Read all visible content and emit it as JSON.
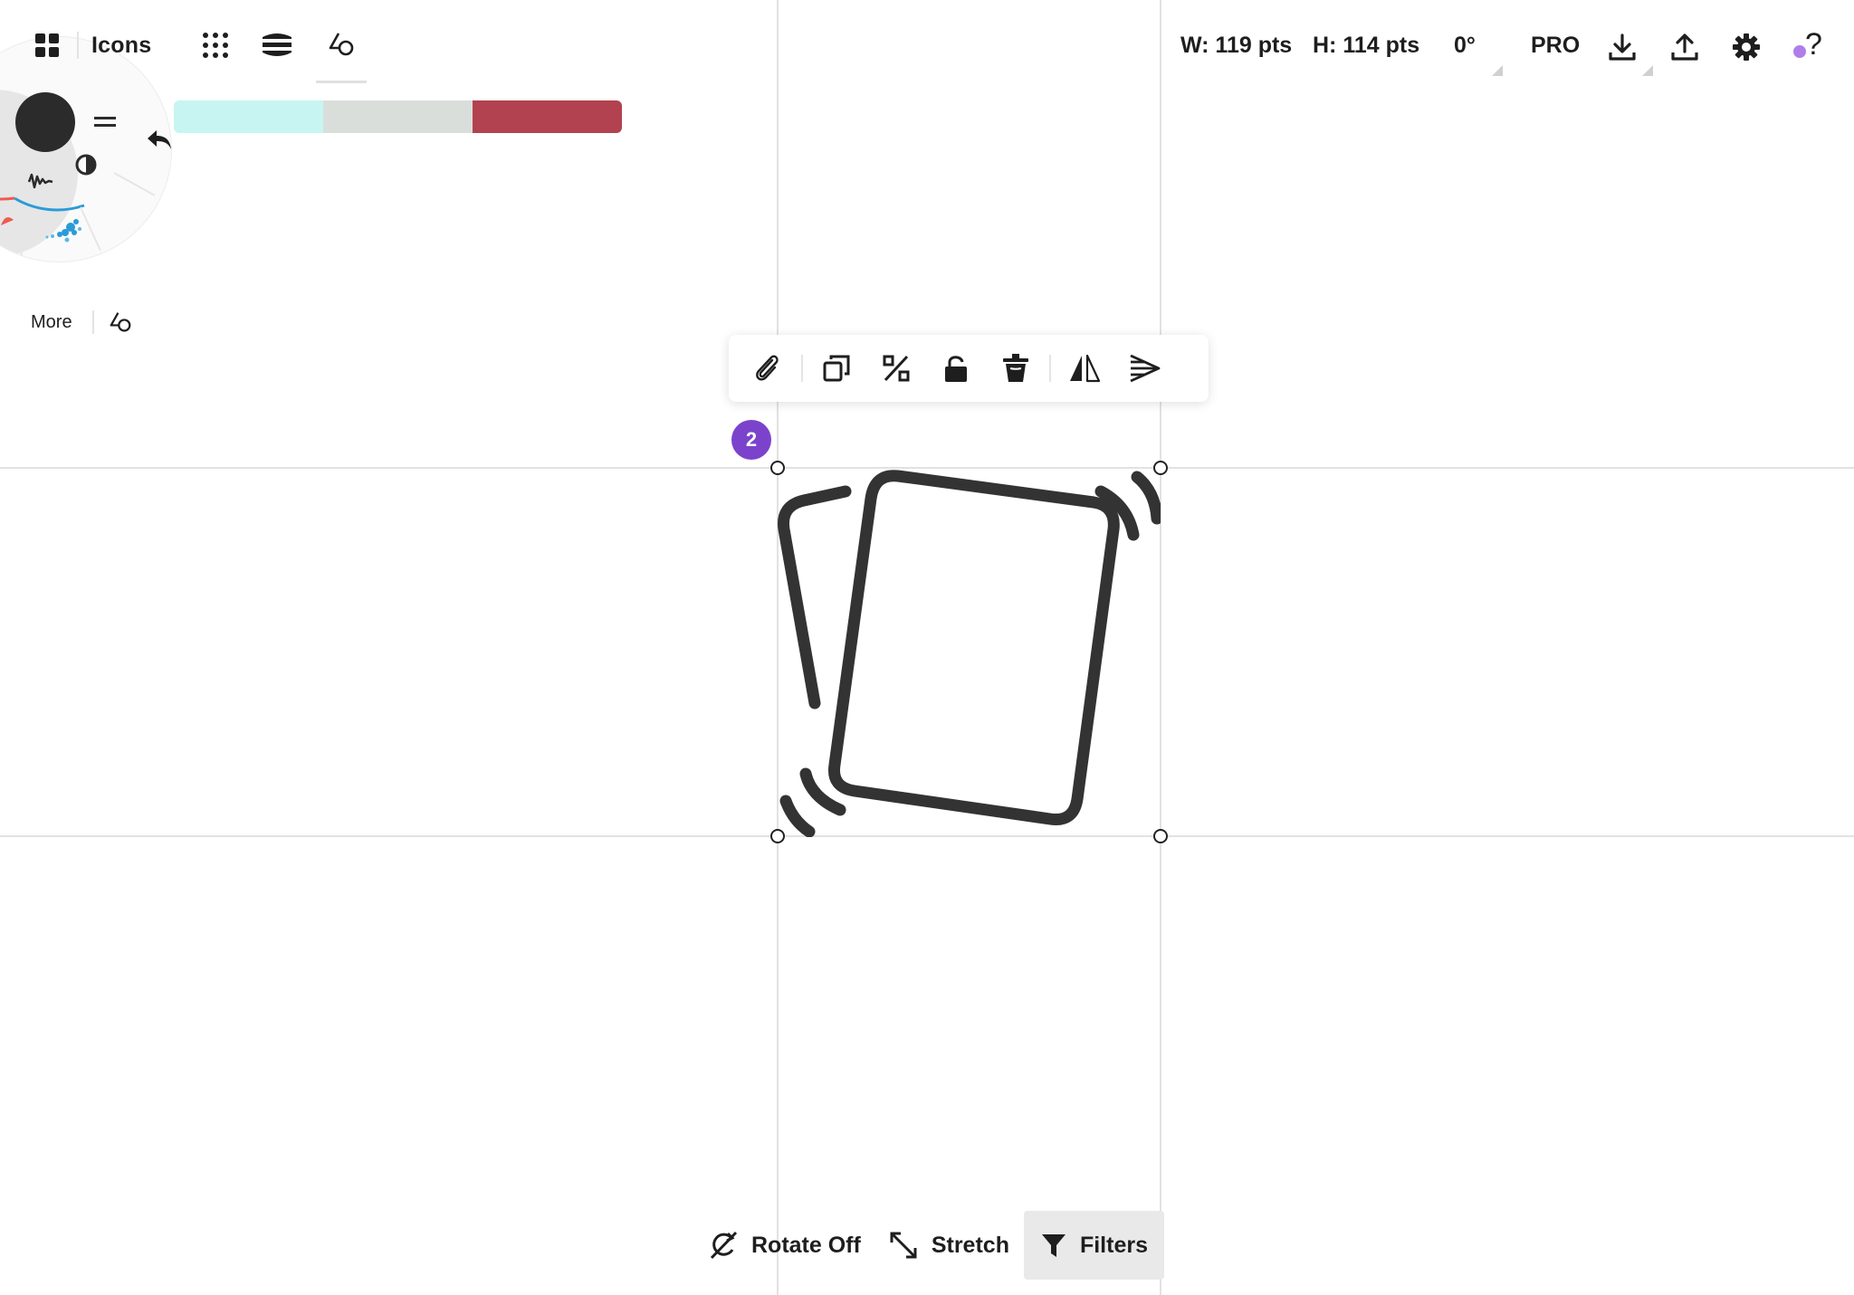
{
  "header": {
    "title": "Icons",
    "icons": [
      "gallery-grid-icon",
      "dots-grid-icon",
      "layers-icon",
      "shapes-icon"
    ]
  },
  "dimensions": {
    "width": "W: 119 pts",
    "height": "H: 114 pts",
    "rotation": "0°"
  },
  "topright": {
    "pro_label": "PRO",
    "help_label": "?",
    "notification_color": "#b07ee8"
  },
  "palette": {
    "colors": [
      "#c7f5f1",
      "#dadedb",
      "#b2424f"
    ]
  },
  "left_panel": {
    "more_label": "More",
    "brush_color": "#2b2b2b"
  },
  "selection": {
    "count": "2"
  },
  "floating_toolbar": {
    "items": [
      "attach-icon",
      "duplicate-icon",
      "percent-icon",
      "unlock-icon",
      "trash-icon",
      "flip-horizontal-icon",
      "align-icon"
    ]
  },
  "bottom_toolbar": {
    "rotate_label": "Rotate Off",
    "stretch_label": "Stretch",
    "filters_label": "Filters"
  },
  "colors": {
    "accent": "#7b43cc",
    "stroke": "#333333"
  }
}
